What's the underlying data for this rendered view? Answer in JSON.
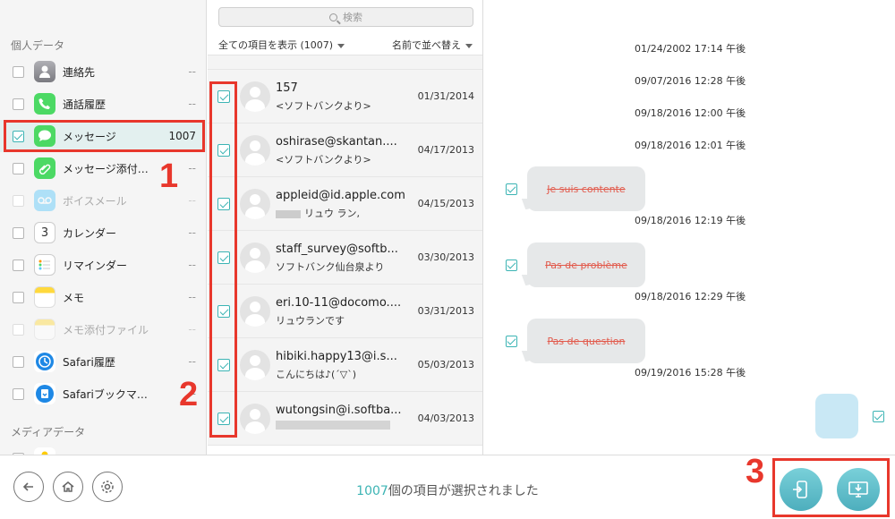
{
  "sidebar": {
    "section_personal": "個人データ",
    "section_media": "メディアデータ",
    "items": [
      {
        "label": "連絡先",
        "count": "--",
        "checked": false,
        "icon": "contacts-icon",
        "color": "#8e8e93"
      },
      {
        "label": "通話履歴",
        "count": "--",
        "checked": false,
        "icon": "phone-icon",
        "color": "#4cd964"
      },
      {
        "label": "メッセージ",
        "count": "1007",
        "checked": true,
        "icon": "messages-icon",
        "color": "#4cd964"
      },
      {
        "label": "メッセージ添付…",
        "count": "--",
        "checked": false,
        "icon": "message-attachment-icon",
        "color": "#4cd964"
      },
      {
        "label": "ボイスメール",
        "count": "--",
        "checked": false,
        "icon": "voicemail-icon",
        "color": "#5ac8fa"
      },
      {
        "label": "カレンダー",
        "count": "--",
        "checked": false,
        "icon": "calendar-icon",
        "color": "#ffffff"
      },
      {
        "label": "リマインダー",
        "count": "--",
        "checked": false,
        "icon": "reminders-icon",
        "color": "#ffffff"
      },
      {
        "label": "メモ",
        "count": "--",
        "checked": false,
        "icon": "notes-icon",
        "color": "#ffcc00"
      },
      {
        "label": "メモ添付ファイル",
        "count": "--",
        "checked": false,
        "icon": "notes-attachment-icon",
        "color": "#ffcc00"
      },
      {
        "label": "Safari履歴",
        "count": "--",
        "checked": false,
        "icon": "safari-history-icon",
        "color": "#1e88e5"
      },
      {
        "label": "Safariブックマ…",
        "count": "--",
        "checked": false,
        "icon": "safari-bookmark-icon",
        "color": "#1e88e5"
      }
    ],
    "calendar_day": "3"
  },
  "list": {
    "search_placeholder": "検索",
    "filter_label": "全ての項目を表示 (1007)",
    "sort_label": "名前で並べ替え",
    "rows": [
      {
        "name": "157",
        "preview": "<ソフトバンクより>",
        "date": "01/31/2014"
      },
      {
        "name": "oshirase@skantan....",
        "preview": "<ソフトバンクより>",
        "date": "04/17/2013"
      },
      {
        "name": "appleid@id.apple.com",
        "preview": "リュウ ラン,",
        "date": "04/15/2013"
      },
      {
        "name": "staff_survey@softb...",
        "preview": "ソフトバンク仙台泉より",
        "date": "03/30/2013"
      },
      {
        "name": "eri.10-11@docomo....",
        "preview": "リュウランです",
        "date": "03/31/2013"
      },
      {
        "name": "hibiki.happy13@i.s...",
        "preview": "こんにちは♪(´▽`)",
        "date": "05/03/2013"
      },
      {
        "name": "wutongsin@i.softba...",
        "preview": "",
        "date": "04/03/2013"
      }
    ]
  },
  "conversation": {
    "timestamps": [
      "01/24/2002 17:14 午後",
      "09/07/2016 12:28 午後",
      "09/18/2016 12:00 午後",
      "09/18/2016 12:01 午後"
    ],
    "messages": [
      {
        "text": "Je suis contente",
        "time": "09/18/2016 12:19 午後"
      },
      {
        "text": "Pas de problème",
        "time": "09/18/2016 12:29 午後"
      },
      {
        "text": "Pas de question",
        "time": "09/19/2016 15:28 午後"
      }
    ]
  },
  "annotations": {
    "n1": "1",
    "n2": "2",
    "n3": "3"
  },
  "bottom": {
    "selected_count": "1007",
    "selected_text": "個の項目が選択されました"
  },
  "colors": {
    "accent": "#3cb4b4",
    "highlight": "#e8372c"
  }
}
